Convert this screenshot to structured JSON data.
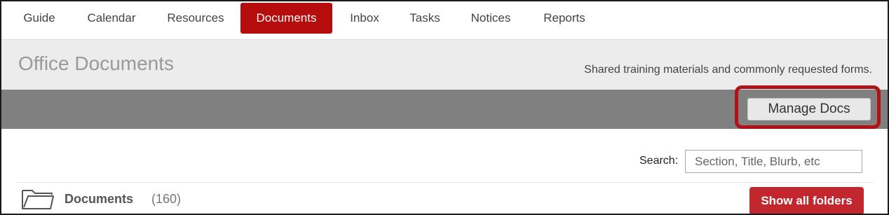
{
  "nav": {
    "items": [
      {
        "label": "Guide",
        "active": false
      },
      {
        "label": "Calendar",
        "active": false
      },
      {
        "label": "Resources",
        "active": false
      },
      {
        "label": "Documents",
        "active": true
      },
      {
        "label": "Inbox",
        "active": false
      },
      {
        "label": "Tasks",
        "active": false
      },
      {
        "label": "Notices",
        "active": false
      },
      {
        "label": "Reports",
        "active": false
      }
    ]
  },
  "header": {
    "title": "Office Documents",
    "subtitle": "Shared training materials and commonly requested forms."
  },
  "toolbar": {
    "manage_label": "Manage Docs"
  },
  "search": {
    "label": "Search:",
    "placeholder": "Section, Title, Blurb, etc",
    "value": ""
  },
  "documents": {
    "label": "Documents",
    "count": "(160)",
    "show_all_label": "Show all folders",
    "icon": "folder-icon"
  },
  "colors": {
    "accent": "#b50d0d",
    "toolbar": "#808080",
    "highlight": "#b01216",
    "button_red": "#c1272d"
  }
}
